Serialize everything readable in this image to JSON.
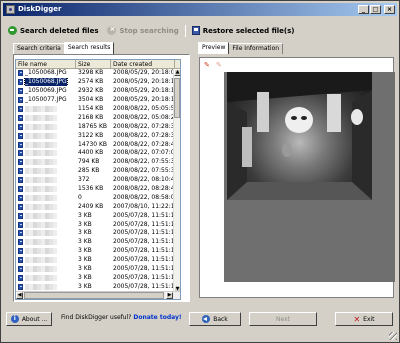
{
  "window": {
    "title": "DiskDigger",
    "buttons": {
      "minimize": "_",
      "maximize": "□",
      "close": "×"
    }
  },
  "toolbar": {
    "search_deleted": "Search deleted files",
    "stop_searching": "Stop searching",
    "restore_selected": "Restore selected file(s)"
  },
  "left_tabs": [
    "Search criteria",
    "Search results"
  ],
  "right_tabs": [
    "Preview",
    "File Information"
  ],
  "table": {
    "columns": [
      "File name",
      "Size",
      "Date created"
    ],
    "rows": [
      {
        "name": "_1050068.JPG",
        "size": "3298 KB",
        "date": "2008/05/29, 20:18:0.."
      },
      {
        "name": "_1050068.JPG",
        "size": "2574 KB",
        "date": "2008/05/29, 20:18:1.."
      },
      {
        "name": "_1050069.JPG",
        "size": "2932 KB",
        "date": "2008/05/29, 20:18:1.."
      },
      {
        "name": "_1050077.JPG",
        "size": "3504 KB",
        "date": "2008/05/29, 20:18:1.."
      },
      {
        "name": "",
        "size": "1154 KB",
        "date": "2008/08/22, 05:05:5.."
      },
      {
        "name": "",
        "size": "2168 KB",
        "date": "2008/08/22, 05:08:2.."
      },
      {
        "name": "",
        "size": "18765 KB",
        "date": "2008/08/22, 07:28:3.."
      },
      {
        "name": "",
        "size": "3122 KB",
        "date": "2008/08/22, 07:28:3.."
      },
      {
        "name": "",
        "size": "14730 KB",
        "date": "2008/08/22, 07:28:4.."
      },
      {
        "name": "",
        "size": "4400 KB",
        "date": "2008/08/22, 07:07:0.."
      },
      {
        "name": "",
        "size": "794 KB",
        "date": "2008/08/22, 07:55:3.."
      },
      {
        "name": "",
        "size": "285 KB",
        "date": "2008/08/22, 07:55:3.."
      },
      {
        "name": "",
        "size": "372",
        "date": "2008/08/22, 08:10:4.."
      },
      {
        "name": "",
        "size": "1536 KB",
        "date": "2008/08/22, 08:28:4.."
      },
      {
        "name": "",
        "size": "0",
        "date": "2008/08/22, 08:58:0.."
      },
      {
        "name": "",
        "size": "2409 KB",
        "date": "2007/08/10, 11:22:1.."
      },
      {
        "name": "",
        "size": "3 KB",
        "date": "2005/07/28, 11:51:1.."
      },
      {
        "name": "",
        "size": "3 KB",
        "date": "2005/07/28, 11:51:1.."
      },
      {
        "name": "",
        "size": "3 KB",
        "date": "2005/07/28, 11:51:1.."
      },
      {
        "name": "",
        "size": "3 KB",
        "date": "2005/07/28, 11:51:1.."
      },
      {
        "name": "",
        "size": "3 KB",
        "date": "2005/07/28, 11:51:1.."
      },
      {
        "name": "",
        "size": "3 KB",
        "date": "2005/07/28, 11:51:1.."
      },
      {
        "name": "",
        "size": "3 KB",
        "date": "2005/07/28, 11:51:1.."
      },
      {
        "name": "",
        "size": "3 KB",
        "date": "2005/07/28, 11:51:1.."
      },
      {
        "name": "",
        "size": "3 KB",
        "date": "2005/07/28, 11:51:1.."
      }
    ],
    "selected_index": 1
  },
  "bottom": {
    "about": "About ...",
    "useful_text": "Find DiskDigger useful?",
    "donate": "Donate today!",
    "back": "Back",
    "next": "Next",
    "exit": "Exit"
  },
  "colors": {
    "titlebar_start": "#0a246a",
    "titlebar_end": "#a6caf0",
    "face": "#d4d0c8",
    "selection": "#0a246a"
  }
}
